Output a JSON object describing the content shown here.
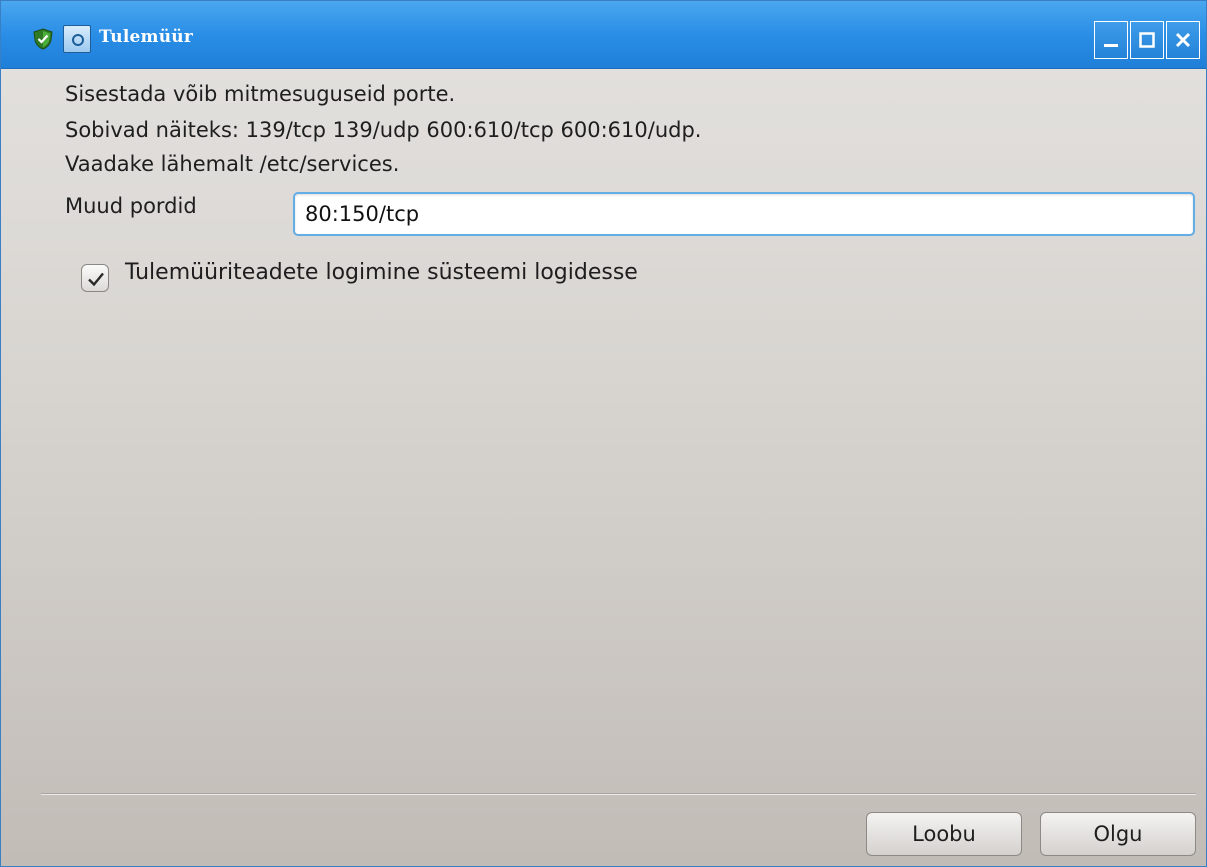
{
  "window": {
    "title": "Tulemüür",
    "controls": {
      "minimize_icon": "minimize-icon",
      "maximize_icon": "maximize-icon",
      "close_icon": "close-icon"
    },
    "accent_color": "#2a8ee6"
  },
  "info": {
    "line1": "Sisestada võib mitmesuguseid porte.",
    "line2": "Sobivad näiteks: 139/tcp 139/udp 600:610/tcp 600:610/udp.",
    "line3": "Vaadake lähemalt /etc/services."
  },
  "ports": {
    "label": "Muud pordid",
    "value": "80:150/tcp"
  },
  "logging": {
    "label": "Tulemüüriteadete logimine süsteemi logidesse",
    "checked": true
  },
  "buttons": {
    "cancel": "Loobu",
    "ok": "Olgu"
  }
}
